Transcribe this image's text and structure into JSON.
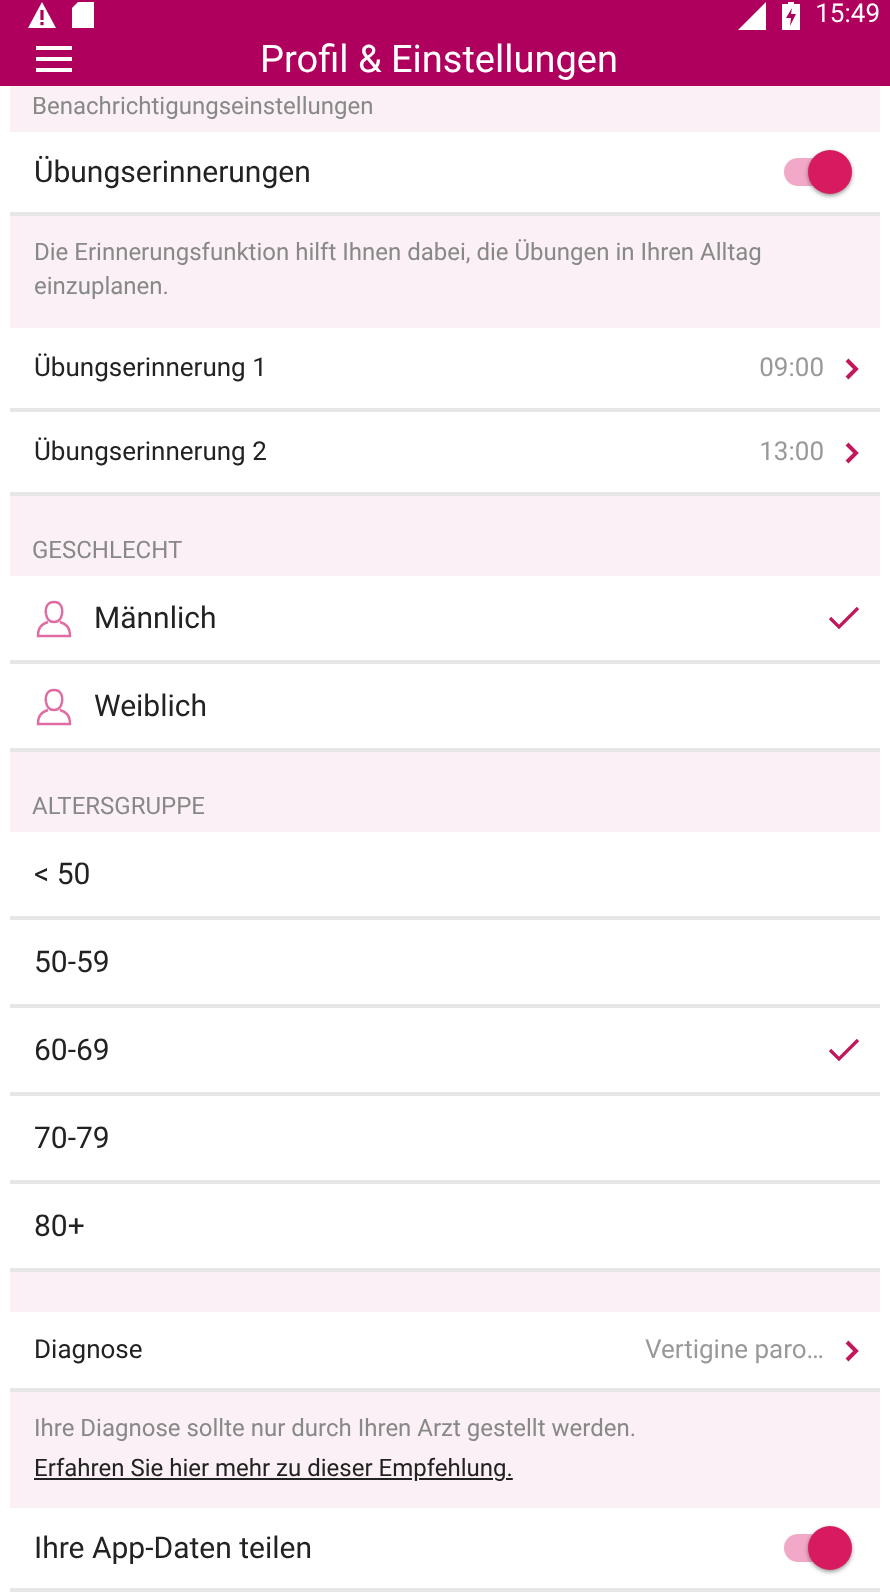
{
  "status_bar": {
    "time": "15:49"
  },
  "app_bar": {
    "title": "Profil & Einstellungen"
  },
  "notifications": {
    "header": "Benachrichtigungseinstellungen",
    "toggle": {
      "label": "Übungserinnerungen",
      "on": true
    },
    "info": "Die Erinnerungsfunktion hilft Ihnen dabei, die Übungen in Ihren Alltag einzuplanen.",
    "reminders": [
      {
        "label": "Übungserinnerung 1",
        "value": "09:00"
      },
      {
        "label": "Übungserinnerung 2",
        "value": "13:00"
      }
    ]
  },
  "gender": {
    "header": "GESCHLECHT",
    "options": [
      {
        "label": "Männlich",
        "selected": true
      },
      {
        "label": "Weiblich",
        "selected": false
      }
    ]
  },
  "age_group": {
    "header": "ALTERSGRUPPE",
    "options": [
      {
        "label": "< 50",
        "selected": false
      },
      {
        "label": "50-59",
        "selected": false
      },
      {
        "label": "60-69",
        "selected": true
      },
      {
        "label": "70-79",
        "selected": false
      },
      {
        "label": "80+",
        "selected": false
      }
    ]
  },
  "diagnosis": {
    "label": "Diagnose",
    "value": "Vertigine paro…",
    "info": "Ihre Diagnose sollte nur durch Ihren Arzt gestellt werden.",
    "link": "Erfahren Sie hier mehr zu dieser Empfehlung."
  },
  "share": {
    "label": "Ihre App-Daten teilen",
    "on": true
  }
}
